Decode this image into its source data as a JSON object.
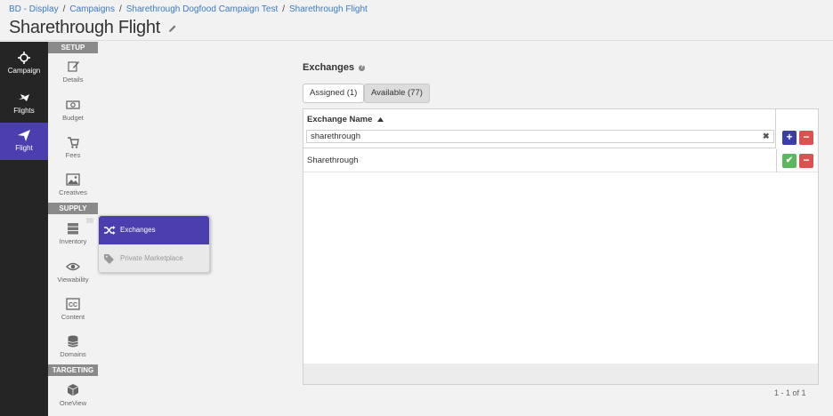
{
  "breadcrumb": {
    "items": [
      "BD - Display",
      "Campaigns",
      "Sharethrough Dogfood Campaign Test",
      "Sharethrough Flight"
    ],
    "separator": "/"
  },
  "page": {
    "title": "Sharethrough Flight"
  },
  "leftnav": {
    "items": [
      {
        "label": "Campaign",
        "icon": "crosshair-icon",
        "active": false
      },
      {
        "label": "Flights",
        "icon": "planes-icon",
        "active": false
      },
      {
        "label": "Flight",
        "icon": "plane-icon",
        "active": true
      }
    ]
  },
  "subnav": {
    "sections": {
      "setup": "SETUP",
      "supply": "SUPPLY",
      "targeting": "TARGETING"
    },
    "items": {
      "details": "Details",
      "budget": "Budget",
      "fees": "Fees",
      "creatives": "Creatives",
      "inventory": "Inventory",
      "viewability": "Viewability",
      "content": "Content",
      "domains": "Domains",
      "oneview": "OneView"
    }
  },
  "popout": {
    "items": [
      {
        "label": "Exchanges",
        "active": true
      },
      {
        "label": "Private Marketplace",
        "active": false
      }
    ]
  },
  "main": {
    "section_title": "Exchanges",
    "tabs": {
      "assigned": "Assigned (1)",
      "available": "Available (77)"
    },
    "grid": {
      "column": "Exchange Name",
      "filter_value": "sharethrough",
      "rows": [
        "Sharethrough"
      ],
      "pager": "1 - 1 of 1"
    }
  },
  "colors": {
    "accent": "#4b3fb0",
    "nav_bg": "#252525",
    "link": "#3a7cc2",
    "success": "#5cb85c",
    "danger": "#d9534f"
  }
}
